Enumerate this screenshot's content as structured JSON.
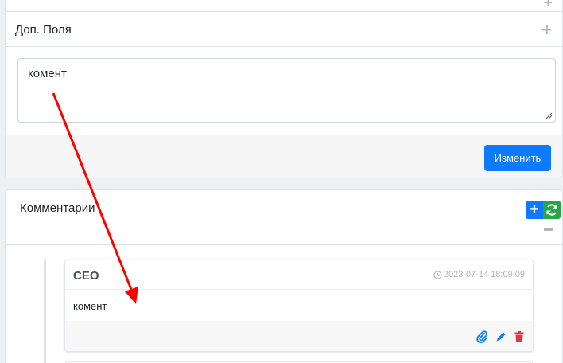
{
  "fields_section": {
    "title": "Доп. Поля",
    "textarea_value": "комент",
    "submit_label": "Изменить"
  },
  "comments_section": {
    "title": "Комментарии",
    "items": [
      {
        "author": "CEO",
        "timestamp": "2023-07-14 18:09:09",
        "text": "комент"
      }
    ]
  },
  "colors": {
    "primary": "#0d7bff",
    "success": "#28a745",
    "danger": "#dc3545",
    "annotation": "#ff0000"
  },
  "icons": {
    "add": "plus-icon",
    "refresh": "refresh-icon",
    "collapse": "minus-icon",
    "time": "clock-icon",
    "attach": "paperclip-icon",
    "edit": "pencil-icon",
    "delete": "trash-icon"
  }
}
